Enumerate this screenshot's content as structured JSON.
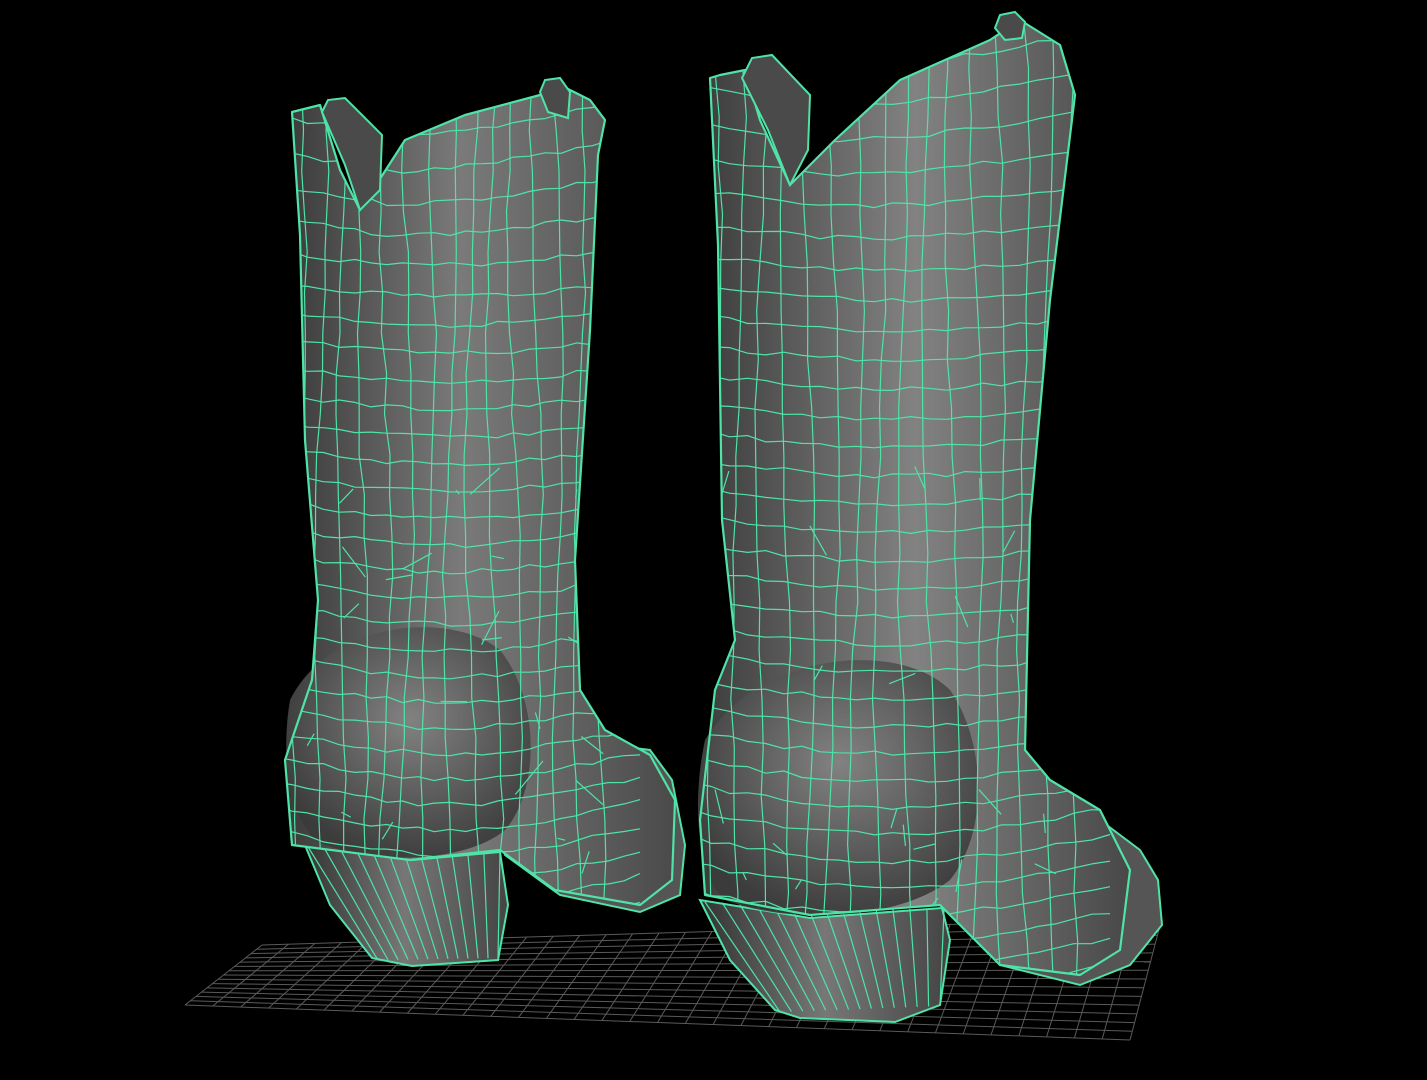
{
  "viewport": {
    "background_color": "#000000",
    "grid_color": "#5a5a5a",
    "wireframe_color": "#4fe3a8",
    "mesh_fill_light": "#8a8a8a",
    "mesh_fill_dark": "#3c3c3c"
  },
  "scene": {
    "objects": [
      {
        "name": "left-boot",
        "type": "polygon-mesh",
        "display": "wireframe-on-shaded"
      },
      {
        "name": "right-boot",
        "type": "polygon-mesh",
        "display": "wireframe-on-shaded"
      }
    ]
  }
}
